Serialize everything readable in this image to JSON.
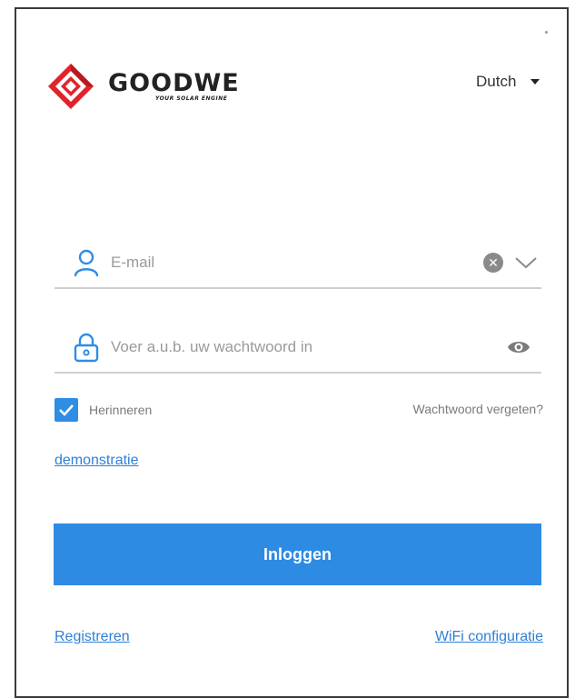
{
  "logo": {
    "name": "GOODWE",
    "tagline": "YOUR SOLAR ENGINE",
    "brand_color": "#e0242a"
  },
  "language": {
    "selected": "Dutch",
    "icon": "caret-down-icon"
  },
  "email": {
    "value": "",
    "placeholder": "E-mail",
    "icon": "user-icon",
    "clear_icon": "clear-icon",
    "dropdown_icon": "chevron-down-icon"
  },
  "password": {
    "value": "",
    "placeholder": "Voer a.u.b. uw wachtwoord in",
    "icon": "lock-icon",
    "visibility_icon": "eye-icon"
  },
  "remember": {
    "label": "Herinneren",
    "checked": true
  },
  "forgot_password": "Wachtwoord vergeten?",
  "demo_link": "demonstratie",
  "login_button": "Inloggen",
  "register_link": "Registreren",
  "wifi_link": "WiFi configuratie",
  "colors": {
    "accent": "#2d8be4",
    "link": "#2f7fd6"
  }
}
